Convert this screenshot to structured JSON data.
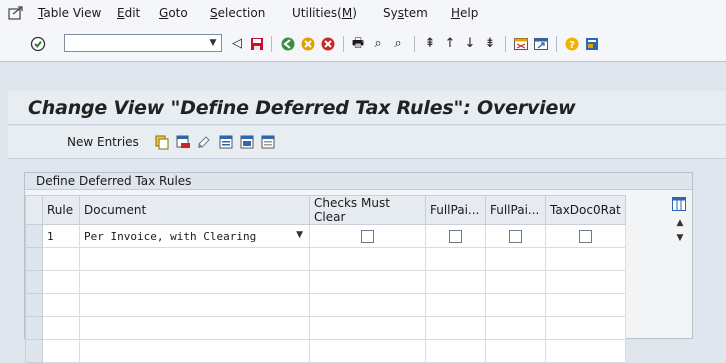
{
  "menu": {
    "items": [
      {
        "label": "Table View",
        "u": "T",
        "rest": "able View"
      },
      {
        "label": "Edit",
        "u": "E",
        "rest": "dit"
      },
      {
        "label": "Goto",
        "u": "G",
        "rest": "oto"
      },
      {
        "label": "Selection",
        "u": "S",
        "rest": "election"
      },
      {
        "label": "Utilities(M)",
        "pre": "Utilities(",
        "u": "M",
        "post": ")"
      },
      {
        "label": "System",
        "pre": "Sy",
        "u": "s",
        "post": "tem"
      },
      {
        "label": "Help",
        "u": "H",
        "rest": "elp"
      }
    ]
  },
  "toolbar": {
    "command_field_value": "",
    "icons": [
      "enter-icon",
      "back-icon",
      "save-icon",
      "back-green-icon",
      "exit-icon",
      "cancel-icon",
      "print-icon",
      "find-icon",
      "find-next-icon",
      "first-page-icon",
      "prev-page-icon",
      "next-page-icon",
      "last-page-icon",
      "new-session-icon",
      "shortcut-icon",
      "help-icon",
      "customize-icon"
    ]
  },
  "title": "Change View \"Define Deferred Tax Rules\": Overview",
  "app_toolbar": {
    "new_entries": "New Entries",
    "icons": [
      "copy-icon",
      "delete-icon",
      "undo-icon",
      "select-all-icon",
      "select-block-icon",
      "deselect-all-icon"
    ]
  },
  "table": {
    "caption": "Define Deferred Tax Rules",
    "columns": [
      "Rule",
      "Document",
      "Checks Must Clear",
      "FullPai...",
      "FullPai...",
      "TaxDoc0Rat"
    ],
    "rows": [
      {
        "rule": "1",
        "document": "Per Invoice, with Clearing",
        "checks_must_clear": false,
        "fullpai1": false,
        "fullpai2": false,
        "taxdoc0rat": false
      },
      {
        "rule": "",
        "document": ""
      },
      {
        "rule": "",
        "document": ""
      },
      {
        "rule": "",
        "document": ""
      },
      {
        "rule": "",
        "document": ""
      },
      {
        "rule": "",
        "document": ""
      }
    ]
  },
  "colors": {
    "accent": "#2f7d32",
    "header_bg": "#dfe5ec"
  }
}
